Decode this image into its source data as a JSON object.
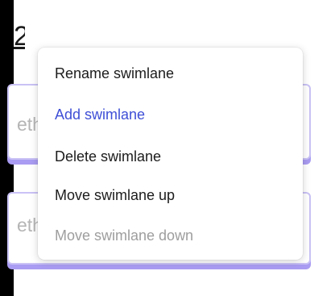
{
  "header": {
    "title_fragment": "2"
  },
  "lanes": [
    {
      "placeholder_fragment": "eth"
    },
    {
      "placeholder_fragment": "eth"
    }
  ],
  "menu": {
    "items": [
      {
        "label": "Rename swimlane",
        "state": "normal"
      },
      {
        "label": "Add swimlane",
        "state": "active"
      },
      {
        "label": "Delete swimlane",
        "state": "normal"
      },
      {
        "label": "Move swimlane up",
        "state": "normal"
      },
      {
        "label": "Move swimlane down",
        "state": "disabled"
      }
    ]
  },
  "colors": {
    "active_item": "#3f4fd6",
    "disabled_item": "#9e9e9e",
    "lane_border": "#c9c2f5",
    "lane_shadow": "#a99cf2"
  }
}
